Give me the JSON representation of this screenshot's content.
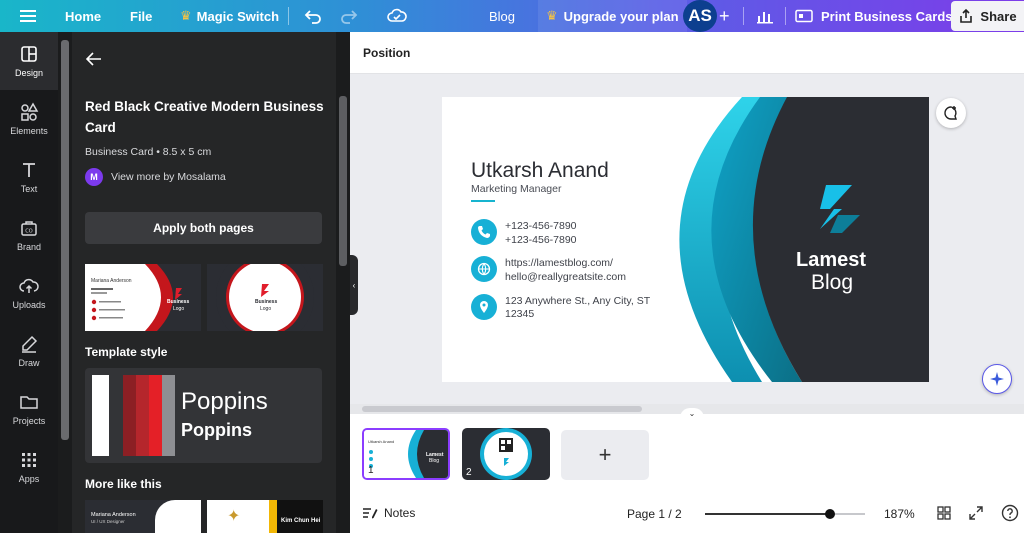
{
  "topbar": {
    "home": "Home",
    "file": "File",
    "magic_switch": "Magic Switch",
    "doc_title": "Blog",
    "upgrade": "Upgrade your plan",
    "avatar_initials": "AS",
    "print": "Print Business Cards",
    "share": "Share"
  },
  "rail": [
    {
      "label": "Design",
      "icon": "layout-icon"
    },
    {
      "label": "Elements",
      "icon": "shapes-icon"
    },
    {
      "label": "Text",
      "icon": "text-icon"
    },
    {
      "label": "Brand",
      "icon": "brand-icon"
    },
    {
      "label": "Uploads",
      "icon": "upload-icon"
    },
    {
      "label": "Draw",
      "icon": "pen-icon"
    },
    {
      "label": "Projects",
      "icon": "folder-icon"
    },
    {
      "label": "Apps",
      "icon": "apps-icon"
    }
  ],
  "panel": {
    "title": "Red Black Creative Modern Business Card",
    "subtitle": "Business Card • 8.5 x 5 cm",
    "author_initial": "M",
    "author": "View more by Mosalama",
    "apply": "Apply both pages",
    "thumb1_name": "Mariana Anderson",
    "thumb1_brand_1": "Business",
    "thumb1_brand_2": "Logo",
    "thumb2_brand_1": "Business",
    "thumb2_brand_2": "Logo",
    "template_style": "Template style",
    "font_regular": "Poppins",
    "font_bold": "Poppins",
    "more_like_this": "More like this",
    "more_thumb1_name": "Mariana Anderson",
    "more_thumb1_role": "UI / UX Designer",
    "more_thumb3_name": "Kim Chun Hei"
  },
  "canvas": {
    "toolbar_label": "Position",
    "card": {
      "name": "Utkarsh Anand",
      "role": "Marketing Manager",
      "phone1": "+123-456-7890",
      "phone2": "+123-456-7890",
      "web": "https://lamestblog.com/",
      "email": "hello@reallygreatsite.com",
      "address1": "123 Anywhere St., Any City, ST",
      "address2": "12345",
      "brand_line1": "Lamest",
      "brand_line2": "Blog"
    }
  },
  "pages": {
    "thumb1_name": "Utkarsh Anand",
    "thumb1_brand_1": "Lamest",
    "thumb1_brand_2": "Blog",
    "page1_number": "1",
    "page2_number": "2",
    "add_label": "+"
  },
  "bottom": {
    "notes": "Notes",
    "page_info": "Page 1 / 2",
    "zoom_fraction": 0.78,
    "zoom": "187%"
  },
  "colors": {
    "accent_teal": "#17b0d6",
    "card_dark": "#2b2d33",
    "panel_bg": "#252627",
    "rail_bg": "#18191b"
  }
}
